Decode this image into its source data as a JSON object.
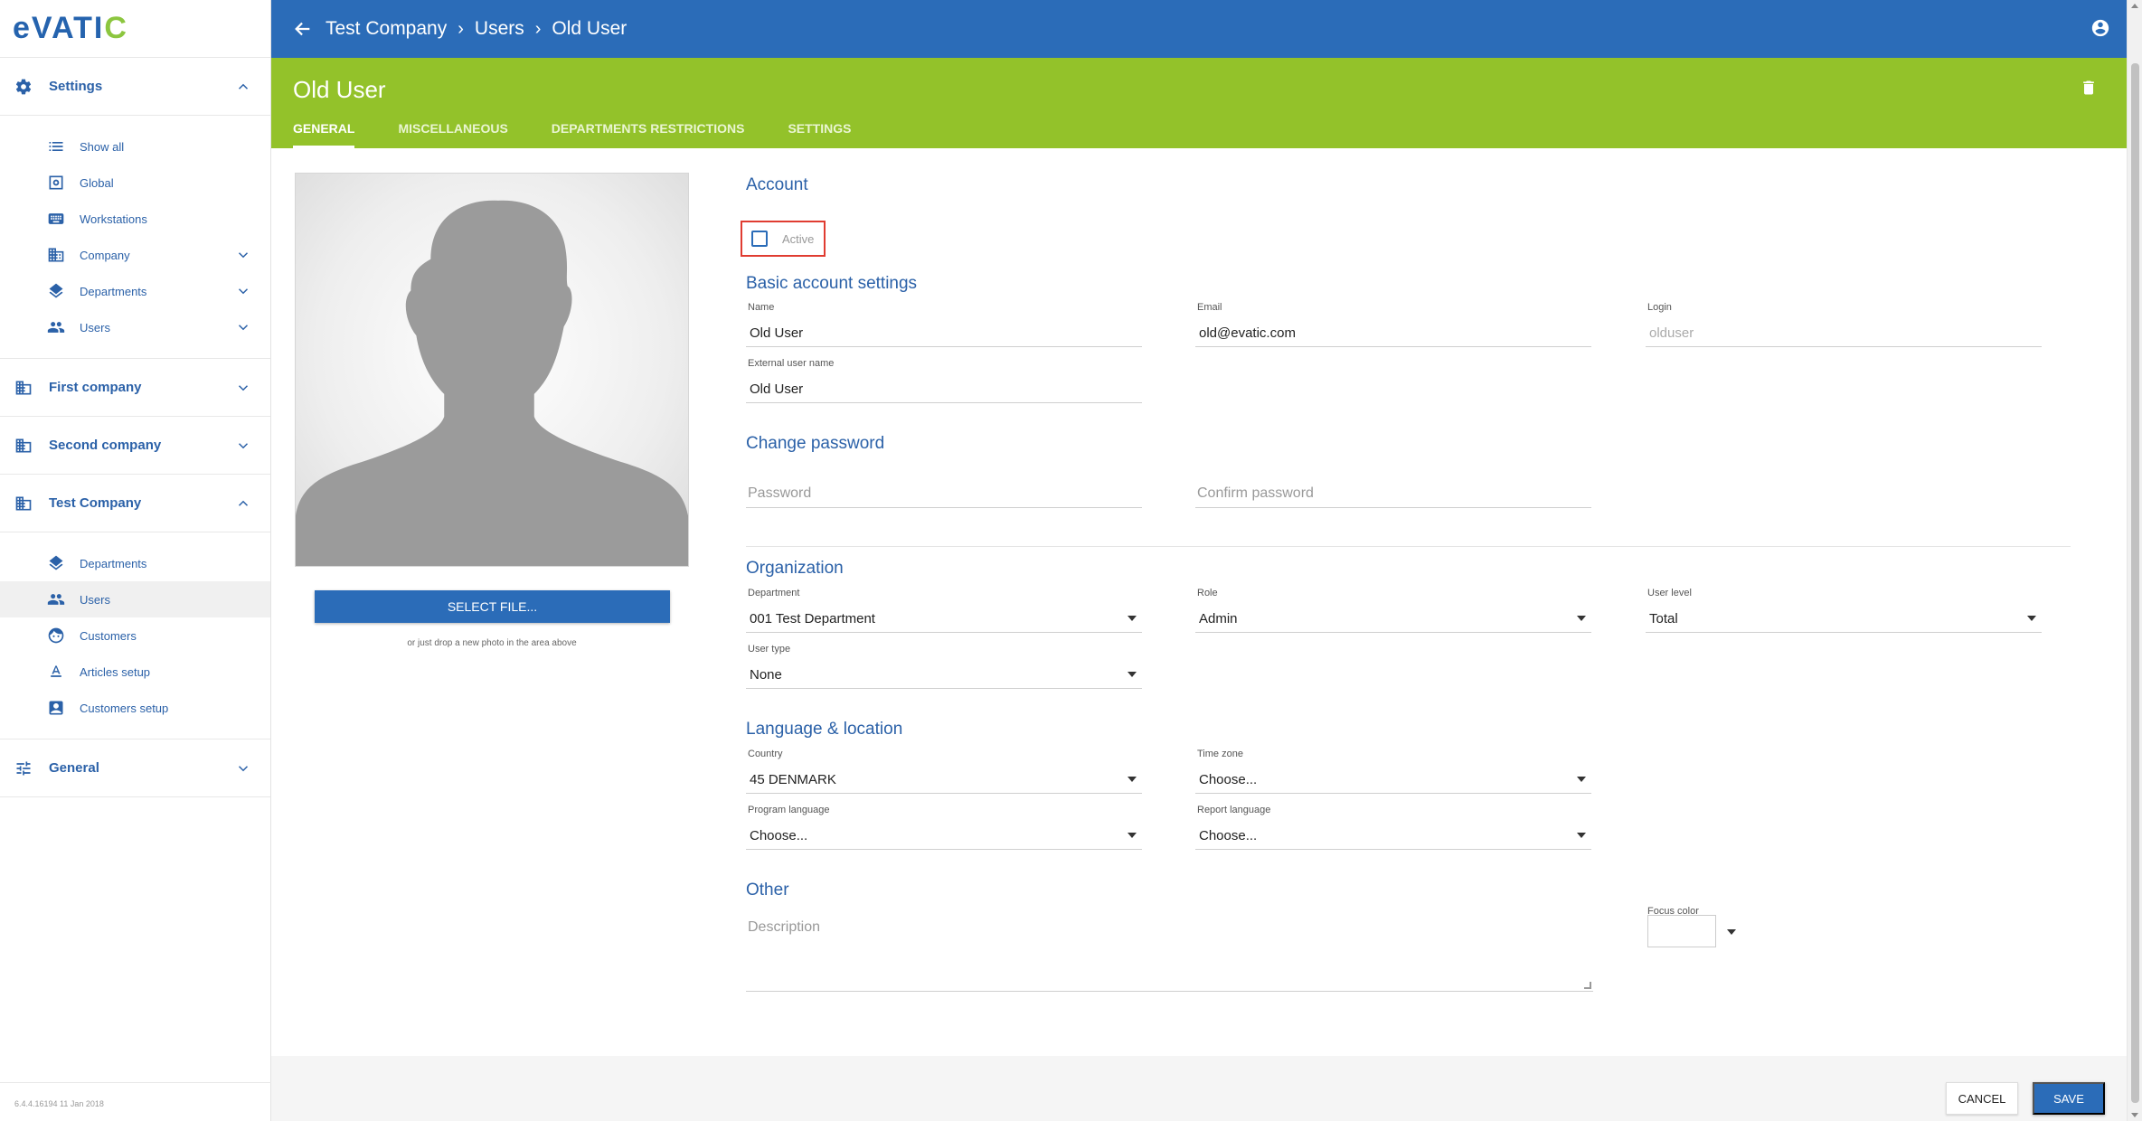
{
  "app": {
    "logo": "eVATIC",
    "version": "6.4.4.16194 11 Jan 2018"
  },
  "sidebar": {
    "settings": {
      "label": "Settings",
      "items": [
        {
          "label": "Show all",
          "icon": "list-icon"
        },
        {
          "label": "Global",
          "icon": "global-settings-icon"
        },
        {
          "label": "Workstations",
          "icon": "keyboard-icon"
        },
        {
          "label": "Company",
          "icon": "building-icon"
        },
        {
          "label": "Departments",
          "icon": "layers-icon"
        },
        {
          "label": "Users",
          "icon": "people-icon"
        }
      ]
    },
    "first_company": {
      "label": "First company"
    },
    "second_company": {
      "label": "Second company"
    },
    "test_company": {
      "label": "Test Company",
      "items": [
        {
          "label": "Departments",
          "icon": "layers-icon"
        },
        {
          "label": "Users",
          "icon": "people-icon"
        },
        {
          "label": "Customers",
          "icon": "face-icon"
        },
        {
          "label": "Articles setup",
          "icon": "text-format-icon"
        },
        {
          "label": "Customers setup",
          "icon": "contact-icon"
        }
      ]
    },
    "general": {
      "label": "General"
    }
  },
  "topbar": {
    "crumbs": [
      "Test Company",
      "Users",
      "Old User"
    ]
  },
  "header": {
    "title": "Old User",
    "tabs": [
      "GENERAL",
      "MISCELLANEOUS",
      "DEPARTMENTS RESTRICTIONS",
      "SETTINGS"
    ]
  },
  "photo": {
    "button": "SELECT FILE...",
    "hint": "or just drop a new photo in the area above"
  },
  "account": {
    "title": "Account",
    "active_label": "Active",
    "active_checked": false
  },
  "basic": {
    "title": "Basic account settings",
    "name_label": "Name",
    "name_value": "Old User",
    "email_label": "Email",
    "email_value": "old@evatic.com",
    "login_label": "Login",
    "login_value": "olduser",
    "external_label": "External user name",
    "external_value": "Old User"
  },
  "password": {
    "title": "Change password",
    "password_placeholder": "Password",
    "confirm_placeholder": "Confirm password"
  },
  "organization": {
    "title": "Organization",
    "department_label": "Department",
    "department_value": "001 Test Department",
    "role_label": "Role",
    "role_value": "Admin",
    "level_label": "User level",
    "level_value": "Total",
    "type_label": "User type",
    "type_value": "None"
  },
  "language": {
    "title": "Language & location",
    "country_label": "Country",
    "country_value": "45 DENMARK",
    "timezone_label": "Time zone",
    "timezone_value": "Choose...",
    "program_label": "Program language",
    "program_value": "Choose...",
    "report_label": "Report language",
    "report_value": "Choose..."
  },
  "other": {
    "title": "Other",
    "description_placeholder": "Description",
    "focus_color_label": "Focus color"
  },
  "footer": {
    "cancel": "CANCEL",
    "save": "SAVE"
  },
  "colors": {
    "topbar": "#2b6cb8",
    "header": "#93c22a",
    "accent": "#2b61a8",
    "highlight": "#e03c31"
  }
}
